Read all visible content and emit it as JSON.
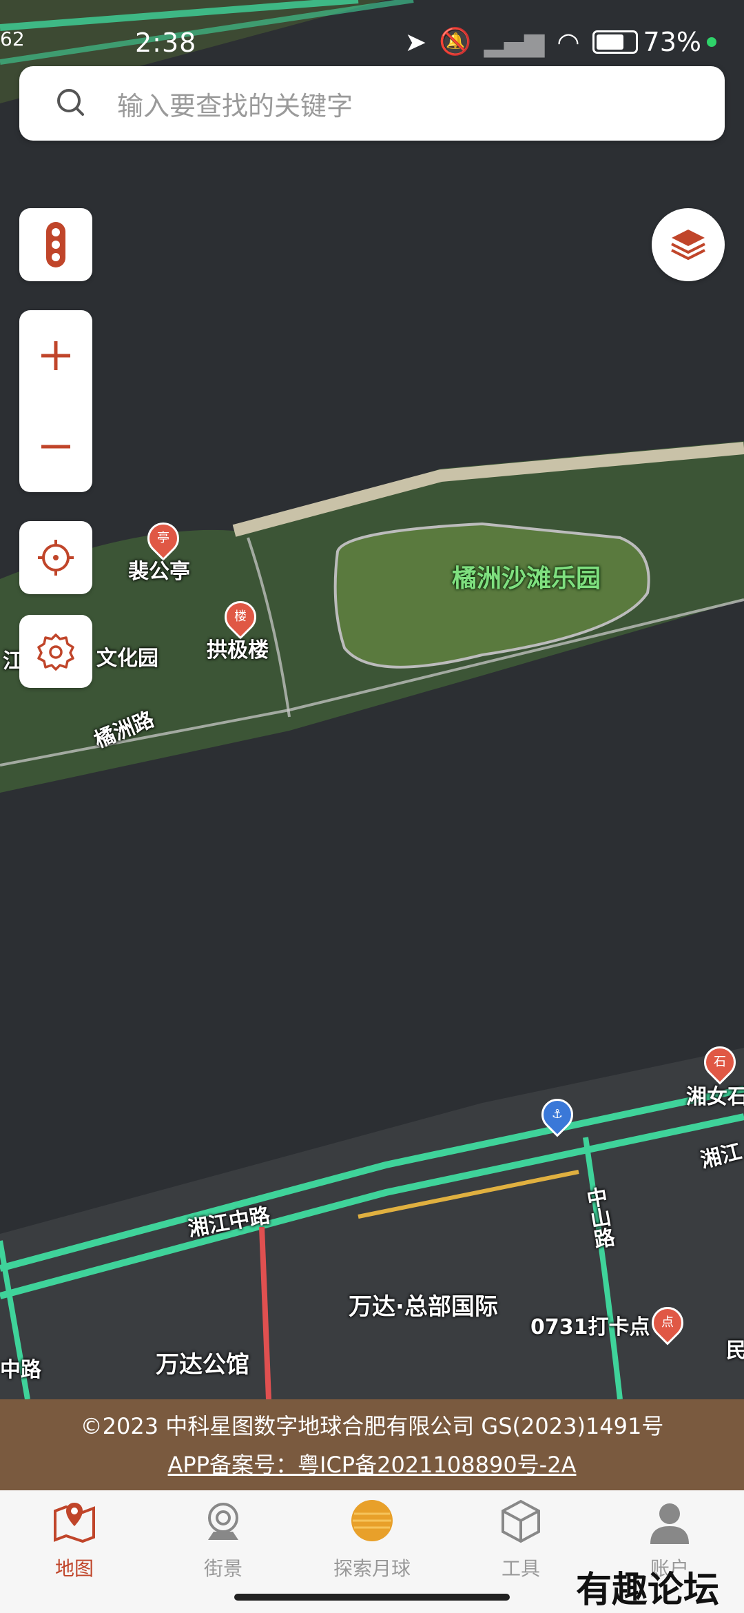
{
  "status_bar": {
    "time": "2:38",
    "side_text": "62",
    "battery_percent": "73%",
    "battery_level": 0.73
  },
  "search": {
    "placeholder": "输入要查找的关键字"
  },
  "controls": {
    "traffic_icon": "traffic-light-icon",
    "zoom_in_icon": "plus-icon",
    "zoom_out_icon": "minus-icon",
    "locate_icon": "crosshair-icon",
    "settings_icon": "gear-icon",
    "layers_icon": "layers-icon"
  },
  "map_labels": {
    "pei_gong_ting": "裴公亭",
    "gong_ji_lou": "拱极楼",
    "wen_hua_yuan": "文化园",
    "jiang_fragment": "江",
    "ju_zhou_road": "橘洲路",
    "park": "橘洲沙滩乐园",
    "xiang_nv": "湘女石",
    "xiangjiang_road_fragment": "湘江",
    "xiangjiang_mid_road": "湘江中路",
    "zhongshan_road": "中山路",
    "wanda_hq": "万达·总部国际",
    "checkin": "0731打卡点",
    "min_fragment": "民",
    "mid_road_fragment": "中路",
    "wanda_mansion": "万达公馆"
  },
  "copyright": {
    "line1": "©2023 中科星图数字地球合肥有限公司 GS(2023)1491号",
    "line2": "APP备案号：粤ICP备2021108890号-2A"
  },
  "tabs": [
    {
      "label": "地图",
      "icon": "map-icon",
      "active": true
    },
    {
      "label": "街景",
      "icon": "camera-icon",
      "active": false
    },
    {
      "label": "探索月球",
      "icon": "moon-icon",
      "active": false
    },
    {
      "label": "工具",
      "icon": "cube-icon",
      "active": false
    },
    {
      "label": "账户",
      "icon": "user-icon",
      "active": false
    }
  ],
  "watermark": "有趣论坛",
  "colors": {
    "accent": "#c0452a",
    "water": "#2b2e31",
    "road": "#3fd39a",
    "footer": "#7a5a3f"
  }
}
